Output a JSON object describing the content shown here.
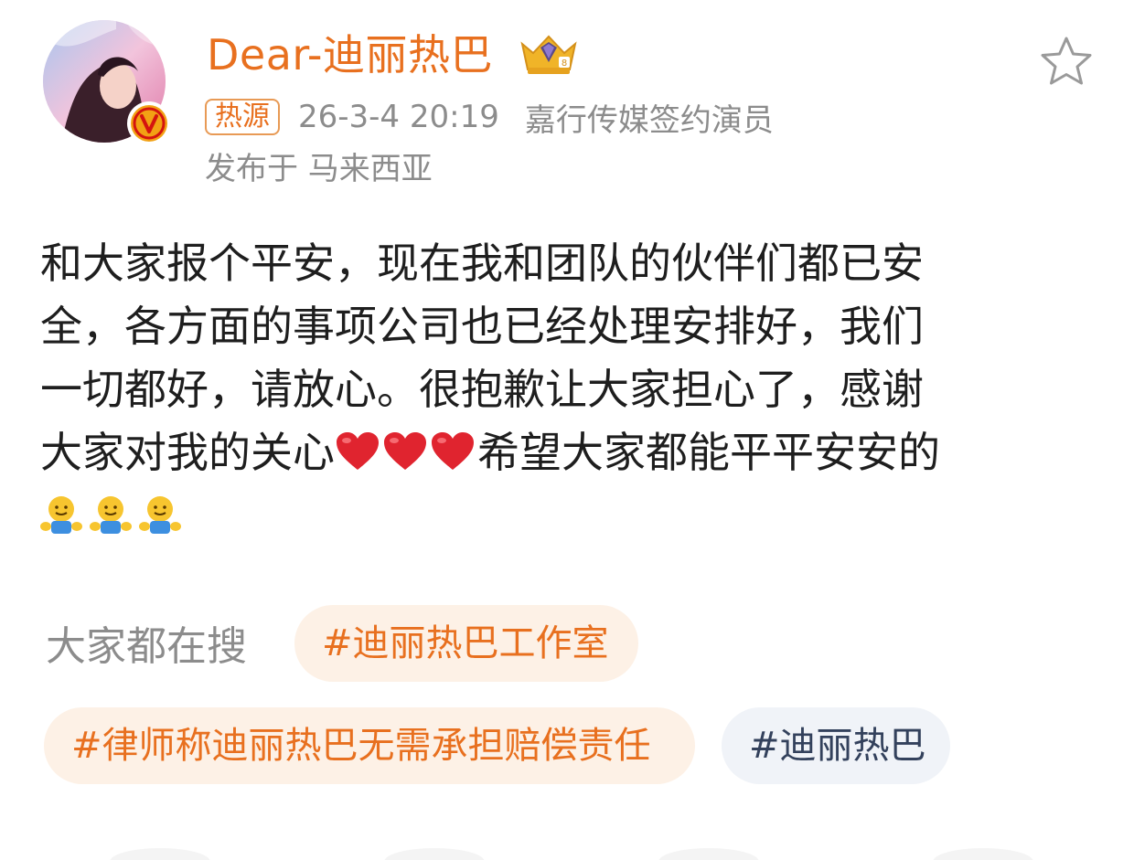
{
  "user": {
    "name": "Dear-迪丽热巴",
    "badge_source": "热源",
    "time": "26-3-4 20:19",
    "description": "嘉行传媒签约演员",
    "location": "发布于 马来西亚"
  },
  "post": {
    "lines": [
      "和大家报个平安，现在我和团队的伙伴们都已安",
      "全，各方面的事项公司也已经处理安排好，我们",
      "一切都好，请放心。很抱歉让大家担心了，感谢"
    ],
    "line4_prefix": "大家对我的关心",
    "line4_suffix": "希望大家都能平平安安的",
    "heart_count": 3,
    "hug_count": 3
  },
  "search": {
    "label": "大家都在搜",
    "tags": [
      "#迪丽热巴工作室",
      "#律师称迪丽热巴无需承担赔偿责任",
      "#迪丽热巴"
    ]
  },
  "colors": {
    "accent_orange": "#e8701f",
    "meta_gray": "#8c8c8c",
    "tag_orange_bg": "#fdf1e6",
    "tag_gray_bg": "#f0f3f8",
    "text_dark": "#1e1e1e"
  },
  "icons": {
    "crown": "crown-icon",
    "verified": "verified-v-icon",
    "favorite": "star-outline-icon",
    "heart": "red-heart-icon",
    "hug": "hugging-face-icon"
  }
}
